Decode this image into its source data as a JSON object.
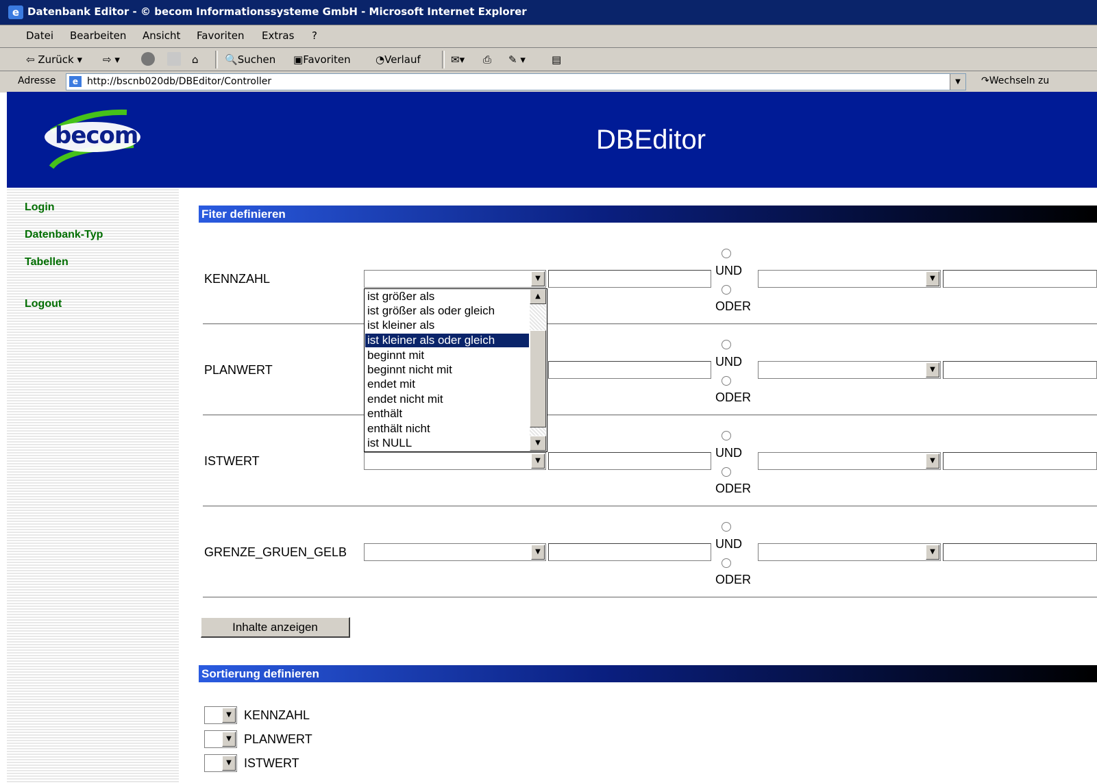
{
  "window": {
    "title": "Datenbank Editor - © becom Informationssysteme GmbH - Microsoft Internet Explorer"
  },
  "menu": [
    "Datei",
    "Bearbeiten",
    "Ansicht",
    "Favoriten",
    "Extras",
    "?"
  ],
  "toolbar": {
    "back": "Zurück",
    "search": "Suchen",
    "favorites": "Favoriten",
    "history": "Verlauf"
  },
  "address": {
    "label": "Adresse",
    "url": "http://bscnb020db/DBEditor/Controller",
    "go": "Wechseln zu"
  },
  "header": {
    "logo": "becom",
    "title": "DBEditor"
  },
  "sidebar": {
    "items": [
      {
        "label": "Login"
      },
      {
        "label": "Datenbank-Typ"
      },
      {
        "label": "Tabellen"
      },
      {
        "label": "Logout"
      }
    ]
  },
  "filter": {
    "heading": "Fiter definieren",
    "and_label": "UND",
    "or_label": "ODER",
    "fields": [
      {
        "label": "KENNZAHL"
      },
      {
        "label": "PLANWERT"
      },
      {
        "label": "ISTWERT"
      },
      {
        "label": "GRENZE_GRUEN_GELB"
      }
    ],
    "dropdown_options": [
      "ist größer als",
      "ist größer als oder gleich",
      "ist kleiner als",
      "ist kleiner als oder gleich",
      "beginnt mit",
      "beginnt nicht mit",
      "endet mit",
      "endet nicht mit",
      "enthält",
      "enthält nicht",
      "ist NULL"
    ],
    "selected_option": "ist kleiner als oder gleich",
    "show_button": "Inhalte anzeigen"
  },
  "sort": {
    "heading": "Sortierung definieren",
    "fields": [
      {
        "label": "KENNZAHL"
      },
      {
        "label": "PLANWERT"
      },
      {
        "label": "ISTWERT"
      }
    ]
  }
}
